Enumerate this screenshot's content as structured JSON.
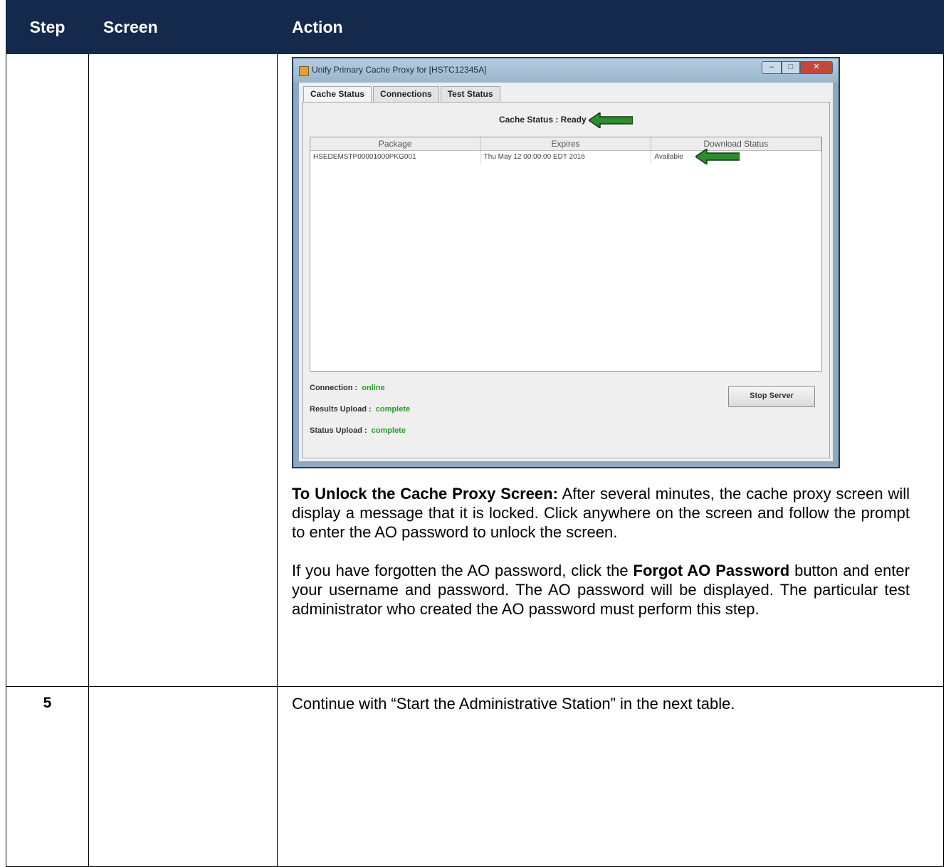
{
  "table": {
    "headers": {
      "step": "Step",
      "screen": "Screen",
      "action": "Action"
    },
    "rows": [
      {
        "step": "",
        "screen": "",
        "window": {
          "title": "Unify Primary Cache Proxy for [HSTC12345A]",
          "tabs": [
            "Cache Status",
            "Connections",
            "Test Status"
          ],
          "cache_status": "Cache Status : Ready",
          "columns": [
            "Package",
            "Expires",
            "Download Status"
          ],
          "row": {
            "package": "HSEDEMSTP00001000PKG001",
            "expires": "Thu May 12 00:00:00 EDT 2016",
            "download_status": "Available"
          },
          "connection_label": "Connection :",
          "connection_value": "online",
          "results_label": "Results Upload :",
          "results_value": "complete",
          "status_label": "Status Upload :",
          "status_value": "complete",
          "stop_button": "Stop Server",
          "arrow_color": "#2e8b2e"
        },
        "para1_bold": "To Unlock the Cache Proxy Screen:",
        "para1_text": " After several minutes, the cache proxy screen will display a message that it is locked. Click anywhere on the screen and follow the prompt to enter the AO password to unlock the screen.",
        "para2_pre": "If you have forgotten the AO password, click the ",
        "para2_bold": "Forgot AO Password",
        "para2_post": " button and enter  your  username and password. The AO password  will be displayed. The particular test administrator who created the AO password must perform this step."
      },
      {
        "step": "5",
        "screen": "",
        "action": "Continue with “Start the Administrative Station” in the next table."
      }
    ]
  },
  "colors": {
    "header_bg": "#14294b",
    "header_text": "#ffffff"
  }
}
